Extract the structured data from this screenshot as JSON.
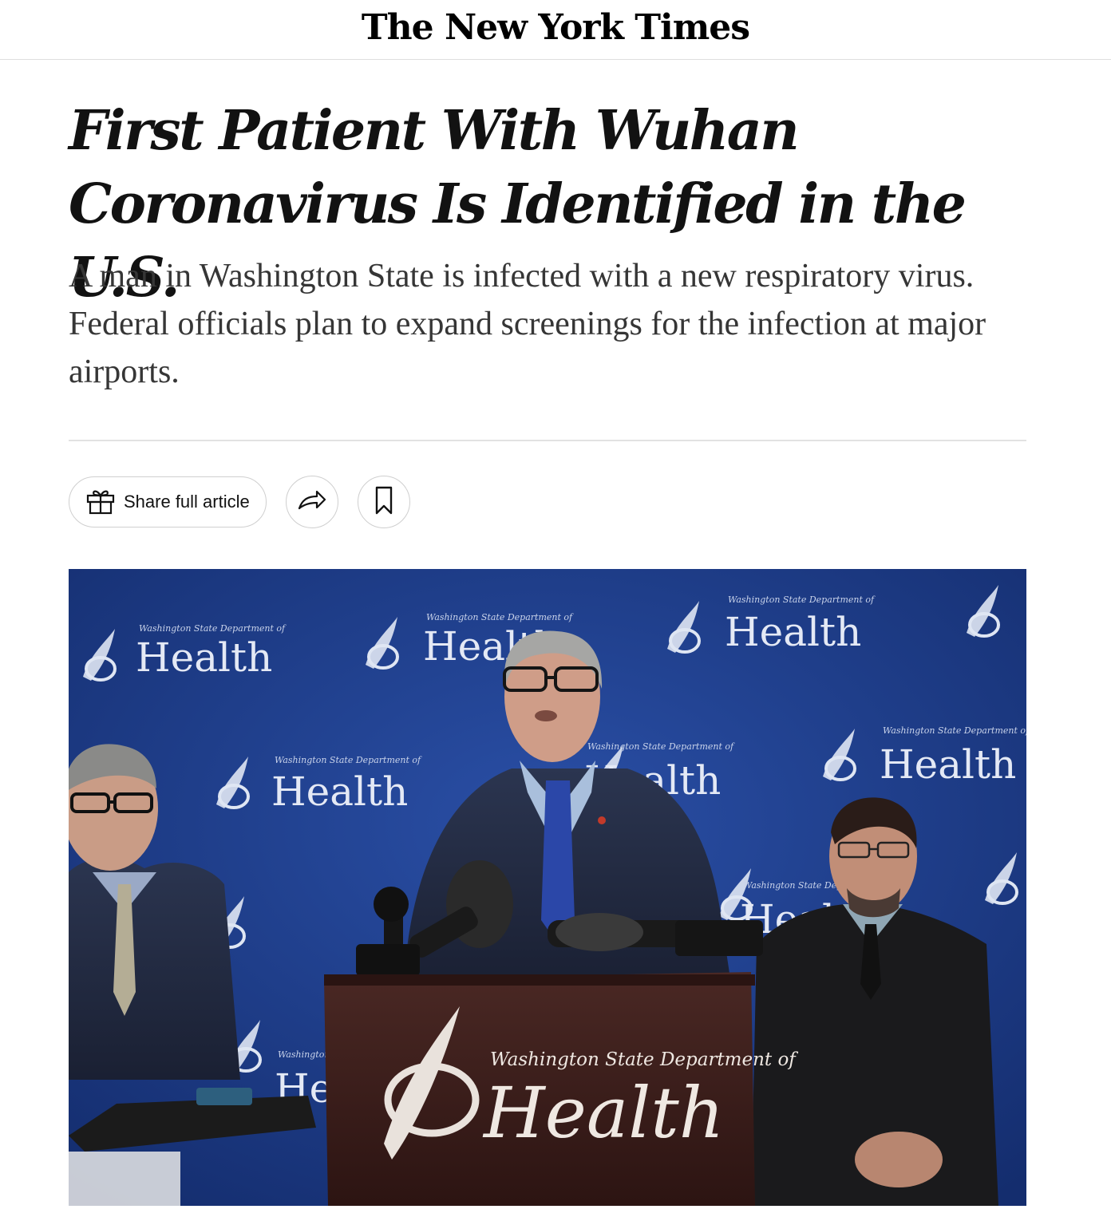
{
  "masthead": {
    "logo": "The New York Times"
  },
  "article": {
    "headline": "First Patient With Wuhan Coronavirus Is Identified in the U.S.",
    "summary": "A man in Washington State is infected with a new respiratory virus. Federal officials plan to expand screenings for the infection at major airports."
  },
  "toolbar": {
    "share_label": "Share full article",
    "icons": [
      "gift-icon",
      "forward-arrow-icon",
      "bookmark-icon"
    ]
  },
  "photo": {
    "backdrop_small": "Washington State Department of",
    "backdrop_large": "Health",
    "podium_small": "Washington State Department of",
    "podium_large": "Health",
    "colors": {
      "backdrop": "#1f3f8f",
      "podium": "#3b1f1c"
    }
  }
}
